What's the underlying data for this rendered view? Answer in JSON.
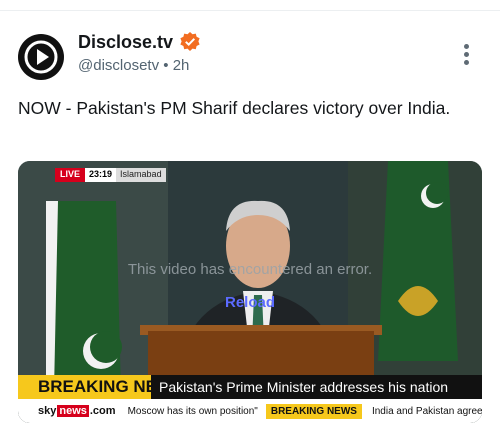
{
  "post": {
    "author_name": "Disclose.tv",
    "handle": "@disclosetv",
    "separator": "•",
    "time": "2h",
    "text": "NOW - Pakistan's PM Sharif declares victory over India."
  },
  "icons": {
    "avatar": "play-logo-icon",
    "verified": "verified-badge-icon",
    "menu": "more-vertical-icon"
  },
  "colors": {
    "verified_orange": "#f26d21",
    "breaking_yellow": "#f6c81c",
    "live_red": "#d6001c",
    "reload_blue": "#5b6bff"
  },
  "video": {
    "live_label": "LIVE",
    "live_time": "23:19",
    "live_location": "Islamabad",
    "error_message": "This video has encountered an error.",
    "reload_label": "Reload",
    "breaking_label": "BREAKING NEWS",
    "headline": "Pakistan's Prime Minister addresses his nation",
    "ticker_brand_a": "sky",
    "ticker_brand_b": "news",
    "ticker_brand_c": ".com",
    "ticker_item_a": "Moscow has its own position\"",
    "ticker_breaking": "BREAKING NEWS",
    "ticker_item_b": "India and Pakistan agree to a full ce"
  }
}
